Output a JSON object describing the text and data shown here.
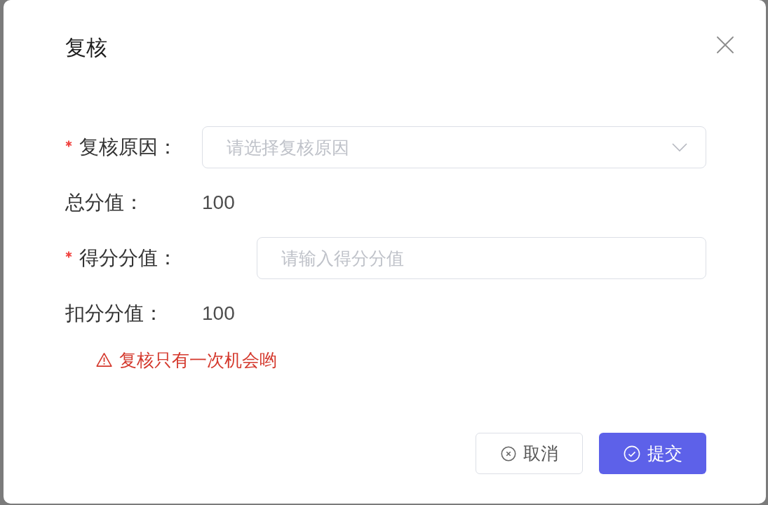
{
  "dialog": {
    "title": "复核"
  },
  "form": {
    "fields": [
      {
        "kind": "select",
        "label": "复核原因：",
        "required": true,
        "placeholder": "请选择复核原因"
      },
      {
        "kind": "static",
        "label": "总分值：",
        "required": false,
        "value": "100"
      },
      {
        "kind": "input",
        "label": "得分分值：",
        "required": true,
        "placeholder": "请输入得分分值"
      },
      {
        "kind": "static",
        "label": "扣分分值：",
        "required": false,
        "value": "100"
      }
    ]
  },
  "warning": {
    "text": "复核只有一次机会哟"
  },
  "buttons": [
    {
      "label": "取消",
      "kind": "default"
    },
    {
      "label": "提交",
      "kind": "primary"
    }
  ]
}
